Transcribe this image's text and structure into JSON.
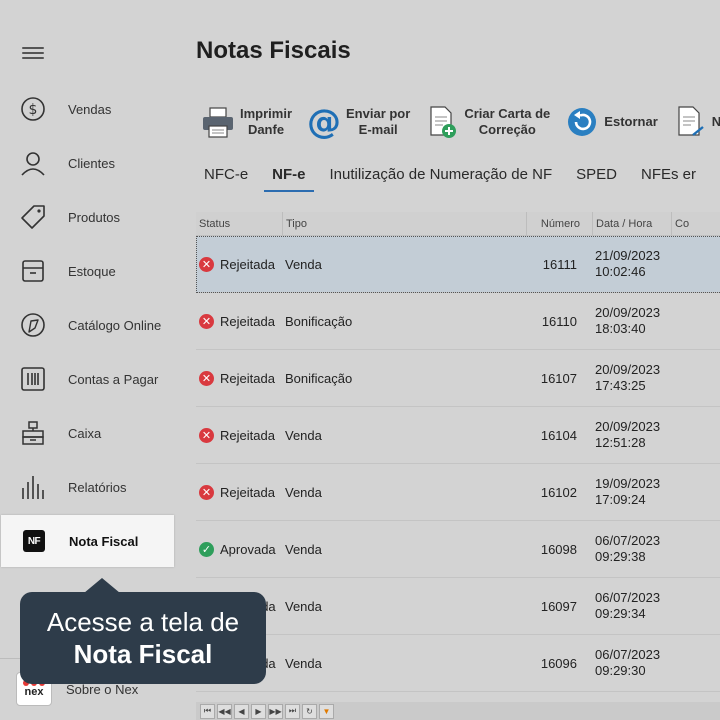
{
  "sidebar": {
    "items": [
      {
        "label": "Vendas"
      },
      {
        "label": "Clientes"
      },
      {
        "label": "Produtos"
      },
      {
        "label": "Estoque"
      },
      {
        "label": "Catálogo Online"
      },
      {
        "label": "Contas a Pagar"
      },
      {
        "label": "Caixa"
      },
      {
        "label": "Relatórios"
      },
      {
        "label": "Nota Fiscal",
        "badge": "NF"
      }
    ],
    "about": {
      "label": "Sobre o Nex",
      "logo_text": "nex"
    }
  },
  "tooltip": {
    "line1": "Acesse a tela de",
    "line2": "Nota Fiscal"
  },
  "page": {
    "title": "Notas Fiscais"
  },
  "toolbar": {
    "print_line1": "Imprimir",
    "print_line2": "Danfe",
    "email_line1": "Enviar por",
    "email_line2": "E-mail",
    "cce_line1": "Criar Carta de",
    "cce_line2": "Correção",
    "estornar": "Estornar",
    "nfc": "NF C"
  },
  "tabs": [
    "NFC-e",
    "NF-e",
    "Inutilização de Numeração de NF",
    "SPED",
    "NFEs er"
  ],
  "grid": {
    "headers": {
      "status": "Status",
      "tipo": "Tipo",
      "numero": "Número",
      "data": "Data / Hora",
      "extra": "Co"
    },
    "rows": [
      {
        "status": "Rejeitada",
        "tipo": "Venda",
        "numero": "16111",
        "date": "21/09/2023",
        "time": "10:02:46"
      },
      {
        "status": "Rejeitada",
        "tipo": "Bonificação",
        "numero": "16110",
        "date": "20/09/2023",
        "time": "18:03:40"
      },
      {
        "status": "Rejeitada",
        "tipo": "Bonificação",
        "numero": "16107",
        "date": "20/09/2023",
        "time": "17:43:25"
      },
      {
        "status": "Rejeitada",
        "tipo": "Venda",
        "numero": "16104",
        "date": "20/09/2023",
        "time": "12:51:28"
      },
      {
        "status": "Rejeitada",
        "tipo": "Venda",
        "numero": "16102",
        "date": "19/09/2023",
        "time": "17:09:24"
      },
      {
        "status": "Aprovada",
        "tipo": "Venda",
        "numero": "16098",
        "date": "06/07/2023",
        "time": "09:29:38"
      },
      {
        "status": "Aprovada",
        "tipo": "Venda",
        "numero": "16097",
        "date": "06/07/2023",
        "time": "09:29:34"
      },
      {
        "status": "Aprovada",
        "tipo": "Venda",
        "numero": "16096",
        "date": "06/07/2023",
        "time": "09:29:30"
      }
    ]
  },
  "colors": {
    "accent": "#2b6cb0",
    "error": "#d9393f",
    "success": "#2e9e5b",
    "tooltip_bg": "#2e3c4a"
  }
}
